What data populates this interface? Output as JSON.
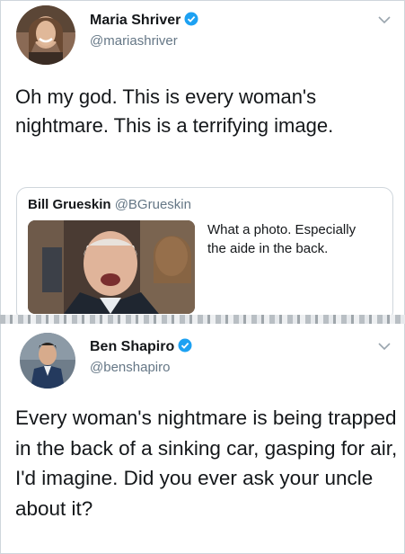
{
  "tweets": [
    {
      "name": "Maria Shriver",
      "handle": "@mariashriver",
      "text": "Oh my god. This is every woman's nightmare. This is a terrifying image.",
      "quoted": {
        "name": "Bill Grueskin",
        "handle": "@BGrueskin",
        "text": "What a photo. Especially the aide in the back."
      }
    },
    {
      "name": "Ben Shapiro",
      "handle": "@benshapiro",
      "text": "Every woman's nightmare is being trapped in the back of a sinking car, gasping for air, I'd imagine. Did you ever ask your uncle about it?"
    }
  ],
  "icons": {
    "verified": "verified-badge-icon",
    "menu": "chevron-down-icon"
  },
  "colors": {
    "verified_blue": "#1da1f2",
    "handle_gray": "#657786",
    "text": "#14171a"
  }
}
